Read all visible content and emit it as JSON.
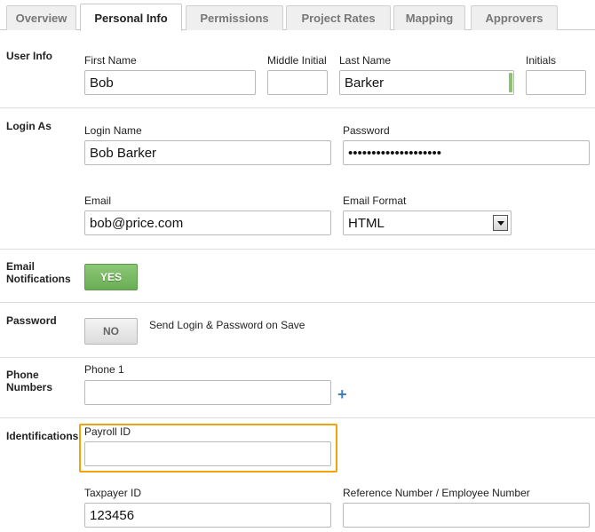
{
  "tabs": [
    {
      "label": "Overview",
      "active": false
    },
    {
      "label": "Personal Info",
      "active": true
    },
    {
      "label": "Permissions",
      "active": false
    },
    {
      "label": "Project Rates",
      "active": false
    },
    {
      "label": "Mapping",
      "active": false
    },
    {
      "label": "Approvers",
      "active": false
    }
  ],
  "user_info": {
    "section_label": "User Info",
    "first_name": {
      "label": "First Name",
      "value": "Bob"
    },
    "middle_initial": {
      "label": "Middle Initial",
      "value": ""
    },
    "last_name": {
      "label": "Last Name",
      "value": "Barker"
    },
    "initials": {
      "label": "Initials",
      "value": ""
    }
  },
  "login_as": {
    "section_label": "Login As",
    "login_name": {
      "label": "Login Name",
      "value": "Bob Barker"
    },
    "password": {
      "label": "Password",
      "value": "••••••••••••••••••••"
    },
    "email": {
      "label": "Email",
      "value": "bob@price.com"
    },
    "email_format": {
      "label": "Email Format",
      "value": "HTML"
    }
  },
  "email_notifications": {
    "section_label_line1": "Email",
    "section_label_line2": "Notifications",
    "toggle_label": "YES"
  },
  "password_section": {
    "section_label": "Password",
    "toggle_label": "NO",
    "send_text": "Send Login & Password on Save"
  },
  "phone_numbers": {
    "section_label_line1": "Phone",
    "section_label_line2": "Numbers",
    "phone1": {
      "label": "Phone 1",
      "value": ""
    },
    "add_icon": "plus-icon",
    "add_glyph": "+"
  },
  "identifications": {
    "section_label": "Identifications",
    "payroll_id": {
      "label": "Payroll ID",
      "value": ""
    },
    "taxpayer_id": {
      "label": "Taxpayer ID",
      "value": "123456"
    },
    "reference_number": {
      "label": "Reference Number / Employee Number",
      "value": ""
    }
  },
  "colors": {
    "highlight": "#f0a30a",
    "toggle_on": "#6aad55",
    "valid_indicator": "#86c46d",
    "add_link": "#3e7fc4"
  }
}
